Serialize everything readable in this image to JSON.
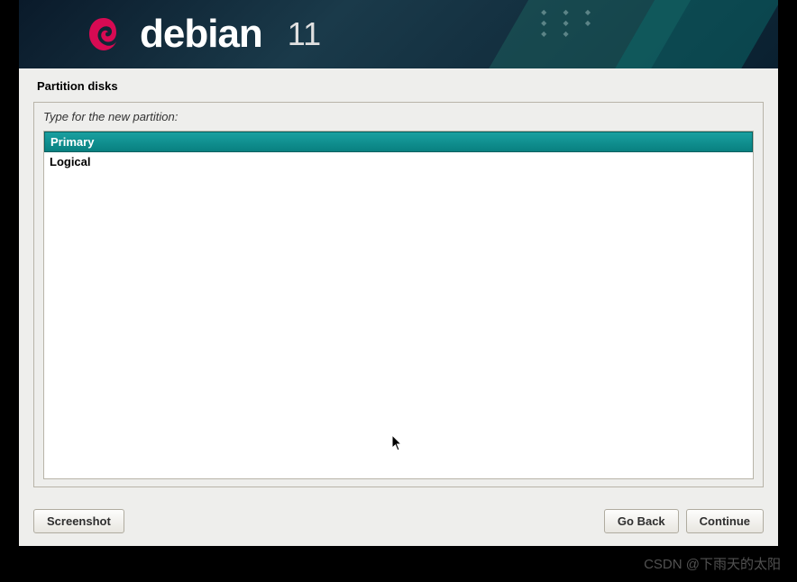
{
  "header": {
    "brand": "debian",
    "version": "11"
  },
  "page": {
    "title": "Partition disks",
    "prompt": "Type for the new partition:"
  },
  "options": [
    {
      "label": "Primary",
      "selected": true
    },
    {
      "label": "Logical",
      "selected": false
    }
  ],
  "buttons": {
    "screenshot": "Screenshot",
    "go_back": "Go Back",
    "continue": "Continue"
  },
  "watermark": "CSDN @下雨天的太阳"
}
